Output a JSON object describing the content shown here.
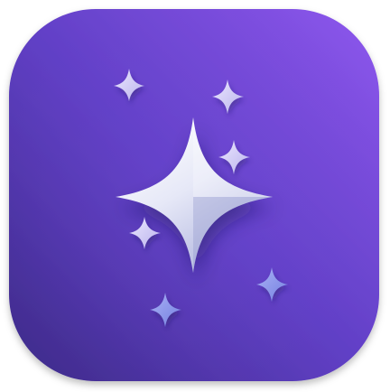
{
  "app_icon": {
    "name": "sparkle-app-icon",
    "colors": {
      "background_top_right": "#8b55ea",
      "background_bottom_left": "#3f2b8c",
      "background_mid": "#5d3bc0",
      "star_highlight": "#ffffff",
      "star_body": "#d9dcf2",
      "star_shadow": "#9ea3d4",
      "small_star_light": "#c8c4f2",
      "small_star_blue": "#8e98ea"
    }
  }
}
